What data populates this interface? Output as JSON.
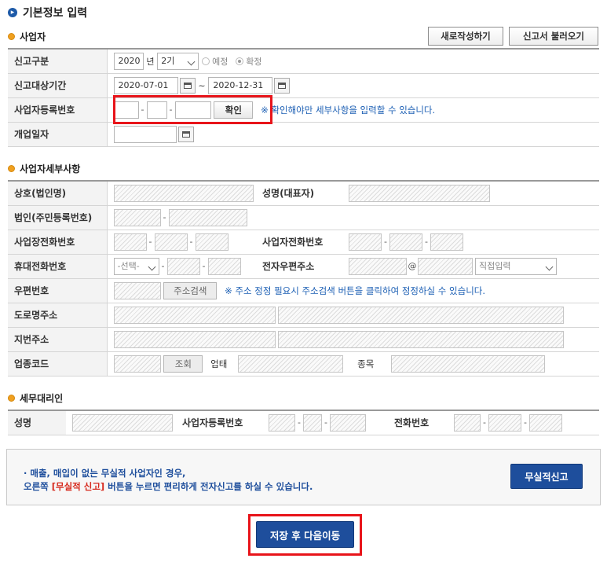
{
  "page_title": "기본정보 입력",
  "sections": {
    "business": "사업자",
    "business_detail": "사업자세부사항",
    "agent": "세무대리인"
  },
  "top_buttons": {
    "new": "새로작성하기",
    "load": "신고서 불러오기"
  },
  "basic": {
    "report_type": {
      "label": "신고구분",
      "year": "2020",
      "year_unit": "년",
      "period": "2기",
      "option_prelim": "예정",
      "option_final": "확정",
      "selected": "확정"
    },
    "report_period": {
      "label": "신고대상기간",
      "start": "2020-07-01",
      "tilde": "~",
      "end": "2020-12-31"
    },
    "biz_reg_no": {
      "label": "사업자등록번호",
      "sep": "-",
      "confirm": "확인",
      "note": "※ 확인해야만 세부사항을 입력할 수 있습니다."
    },
    "open_date": {
      "label": "개업일자"
    }
  },
  "detail": {
    "company": "상호(법인명)",
    "ceo": "성명(대표자)",
    "corp_reg": "법인(주민등록번호)",
    "biz_phone": "사업장전화번호",
    "biz_tel": "사업자전화번호",
    "mobile": "휴대전화번호",
    "mobile_select": "-선택-",
    "email": "전자우편주소",
    "at": "@",
    "email_domain": "직접입력",
    "zip": "우편번호",
    "zip_search": "주소검색",
    "zip_note": "※ 주소 정정 필요시 주소검색 버튼을 클릭하여 정정하실 수 있습니다.",
    "road_addr": "도로명주소",
    "lot_addr": "지번주소",
    "industry_code": "업종코드",
    "lookup": "조회",
    "business_type": "업태",
    "item": "종목",
    "sep": "-"
  },
  "agent": {
    "name": "성명",
    "reg_no": "사업자등록번호",
    "phone": "전화번호",
    "sep": "-"
  },
  "notice": {
    "line1": "· 매출, 매입이 없는 무실적 사업자인 경우,",
    "line2_pre": "오른쪽 ",
    "line2_em": "[무실적 신고]",
    "line2_post": " 버튼을 누르면 편리하게 전자신고를 하실 수 있습니다.",
    "button": "무실적신고"
  },
  "save_next": "저장 후 다음이동",
  "colors": {
    "accent_blue": "#1e4e9c",
    "highlight_red": "#e8141a",
    "note_blue": "#1c5fb4",
    "em_red": "#d6281c"
  }
}
